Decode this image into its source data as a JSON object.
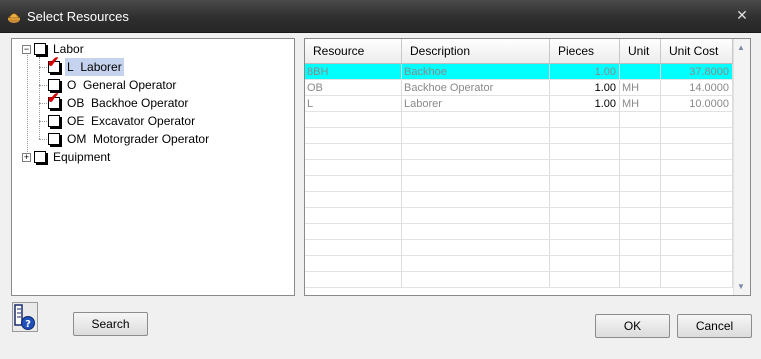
{
  "window": {
    "title": "Select Resources",
    "close_glyph": "✕"
  },
  "tree": {
    "groups": [
      {
        "label": "Labor",
        "expanded": true,
        "expander": "−",
        "checked": false,
        "children": [
          {
            "code": "L",
            "name": "Laborer",
            "checked": true,
            "selected": true
          },
          {
            "code": "O",
            "name": "General Operator",
            "checked": false
          },
          {
            "code": "OB",
            "name": "Backhoe Operator",
            "checked": true
          },
          {
            "code": "OE",
            "name": "Excavator Operator",
            "checked": false
          },
          {
            "code": "OM",
            "name": "Motorgrader Operator",
            "checked": false
          }
        ]
      },
      {
        "label": "Equipment",
        "expanded": false,
        "expander": "+",
        "checked": false
      }
    ],
    "check_glyph": "✔"
  },
  "grid": {
    "columns": [
      "Resource",
      "Description",
      "Pieces",
      "Unit",
      "Unit Cost"
    ],
    "rows": [
      {
        "resource": "8BH",
        "description": "Backhoe",
        "pieces": "1.00",
        "unit": "",
        "unit_cost": "37.8000",
        "highlighted": true
      },
      {
        "resource": "OB",
        "description": "Backhoe Operator",
        "pieces": "1.00",
        "unit": "MH",
        "unit_cost": "14.0000",
        "highlighted": false
      },
      {
        "resource": "L",
        "description": "Laborer",
        "pieces": "1.00",
        "unit": "MH",
        "unit_cost": "10.0000",
        "highlighted": false
      }
    ],
    "highlight_color": "#00ffff",
    "scroll_up_glyph": "▲",
    "scroll_down_glyph": "▼"
  },
  "buttons": {
    "search": "Search",
    "ok": "OK",
    "cancel": "Cancel"
  },
  "icons": {
    "app": "app-hardhat-icon",
    "help": "help-icon"
  }
}
